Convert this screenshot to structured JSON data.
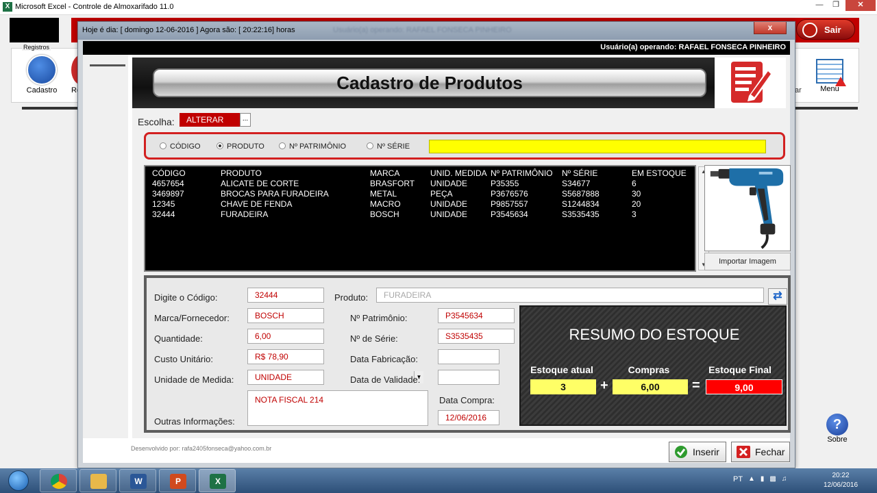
{
  "excel": {
    "window_title": "Microsoft Excel - Controle de Almoxarifado 11.0",
    "sair_label": "Sair",
    "registros_label": "Registros",
    "cadastro_label": "Cadastro",
    "re_label": "Re",
    "ar_label": "ar",
    "menu_label": "Menu",
    "sobre_label": "Sobre"
  },
  "dialog": {
    "title": "Hoje é dia: [ domingo 12-06-2016 ] Agora são: [ 20:22:16] horas",
    "blurred_title": "Usuário(a) operando: RAFAEL FONSECA PINHEIRO",
    "close_label": "x",
    "user_label": "Usuário(a) operando: RAFAEL FONSECA PINHEIRO",
    "header_title": "Cadastro de Produtos",
    "escolha_label": "Escolha:",
    "escolha_value": "ALTERAR",
    "escolha_button": "...",
    "search": {
      "options": [
        "CÓDIGO",
        "PRODUTO",
        "Nº PATRIMÔNIO",
        "Nº SÉRIE"
      ],
      "selected": "PRODUTO",
      "value": ""
    },
    "list": {
      "columns": [
        "CÓDIGO",
        "PRODUTO",
        "MARCA",
        "UNID. MEDIDA",
        "Nº PATRIMÔNIO",
        "Nº SÉRIE",
        "EM ESTOQUE"
      ],
      "rows": [
        [
          "4657654",
          "ALICATE DE CORTE",
          "BRASFORT",
          "UNIDADE",
          "P35355",
          "S34677",
          "6"
        ],
        [
          "3469897",
          "BROCAS PARA FURADEIRA",
          "METAL",
          "PEÇA",
          "P3676576",
          "S5687888",
          "30"
        ],
        [
          "12345",
          "CHAVE DE FENDA",
          "MACRO",
          "UNIDADE",
          "P9857557",
          "S1244834",
          "20"
        ],
        [
          "32444",
          "FURADEIRA",
          "BOSCH",
          "UNIDADE",
          "P3545634",
          "S3535435",
          "3"
        ]
      ]
    },
    "import_image_label": "Importar Imagem",
    "form": {
      "codigo_label": "Digite o Código:",
      "codigo_value": "32444",
      "produto_label": "Produto:",
      "produto_value": "FURADEIRA",
      "marca_label": "Marca/Fornecedor:",
      "marca_value": "BOSCH",
      "patrimonio_label": "Nº Patrimônio:",
      "patrimonio_value": "P3545634",
      "quantidade_label": "Quantidade:",
      "quantidade_value": "6,00",
      "serie_label": "Nº de Série:",
      "serie_value": "S3535435",
      "custo_label": "Custo Unitário:",
      "custo_value": "R$ 78,90",
      "fabricacao_label": "Data Fabricação:",
      "fabricacao_value": "",
      "unidade_label": "Unidade de Medida:",
      "unidade_value": "UNIDADE",
      "validade_label": "Data de Validade:",
      "validade_value": "",
      "outras_label": "Outras Informações:",
      "outras_value": "NOTA FISCAL 214",
      "data_compra_label": "Data Compra:",
      "data_compra_value": "12/06/2016"
    },
    "resumo": {
      "title": "RESUMO DO ESTOQUE",
      "estoque_atual_label": "Estoque atual",
      "estoque_atual_value": "3",
      "compras_label": "Compras",
      "compras_value": "6,00",
      "estoque_final_label": "Estoque Final",
      "estoque_final_value": "9,00",
      "plus": "+",
      "equals": "="
    },
    "developer_label": "Desenvolvido por: rafa2405fonseca@yahoo.com.br",
    "inserir_label": "Inserir",
    "fechar_label": "Fechar"
  },
  "taskbar": {
    "language": "PT",
    "time": "20:22",
    "date": "12/06/2016"
  },
  "colors": {
    "accent_red": "#c00000",
    "search_yellow": "#ffff00",
    "estoque_box_yellow": "#ffff66",
    "estoque_final_red": "#ff0000"
  }
}
